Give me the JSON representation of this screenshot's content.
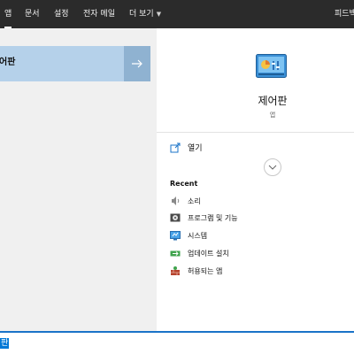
{
  "top_tabs": {
    "apps": "앱",
    "documents": "문서",
    "settings": "설정",
    "email": "전자 메일",
    "more": "더 보기",
    "feedback": "피드백"
  },
  "best_match": {
    "title": "어판"
  },
  "detail": {
    "name": "제어판",
    "type": "앱",
    "open_label": "열기"
  },
  "recent": {
    "heading": "Recent",
    "items": [
      "소리",
      "프로그램 및 기능",
      "시스템",
      "업데이트 설치",
      "허용되는 앱"
    ]
  },
  "search": {
    "query": "판"
  },
  "colors": {
    "accent": "#0078d7",
    "selected_bg": "#b5d1ea",
    "topbar_bg": "#2b2b2b"
  }
}
